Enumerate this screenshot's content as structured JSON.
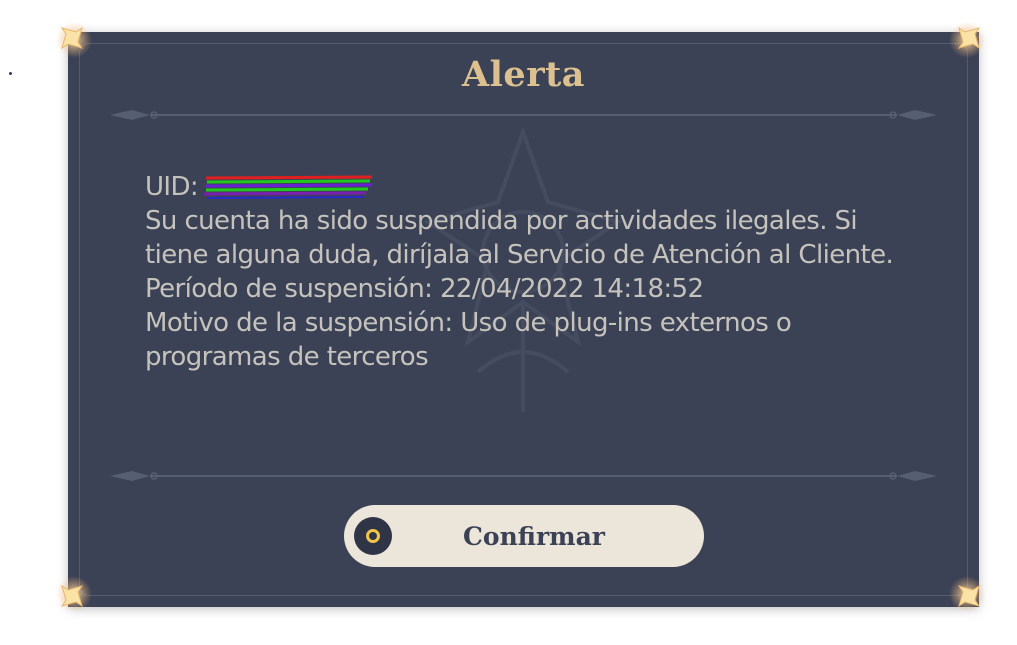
{
  "dialog": {
    "title": "Alerta",
    "uid_label": "UID:",
    "message": "Su cuenta ha sido suspendida por actividades ilegales. Si tiene alguna duda, diríjala al Servicio de Atención al Cliente.",
    "suspension_period": "Período de suspensión: 22/04/2022 14:18:52",
    "suspension_reason": "Motivo de la suspensión: Uso de plug-ins externos o programas de terceros",
    "confirm_label": "Confirmar"
  },
  "colors": {
    "panel_bg": "#3b4255",
    "title_gold": "#dcc08f",
    "body_text": "#c6c3bd",
    "button_bg": "#ece5da",
    "button_icon_ring": "#f0c44a"
  },
  "icons": {
    "corner": "sparkle-corner-icon",
    "confirm": "circle-confirm-icon",
    "divider": "ornament-divider"
  }
}
